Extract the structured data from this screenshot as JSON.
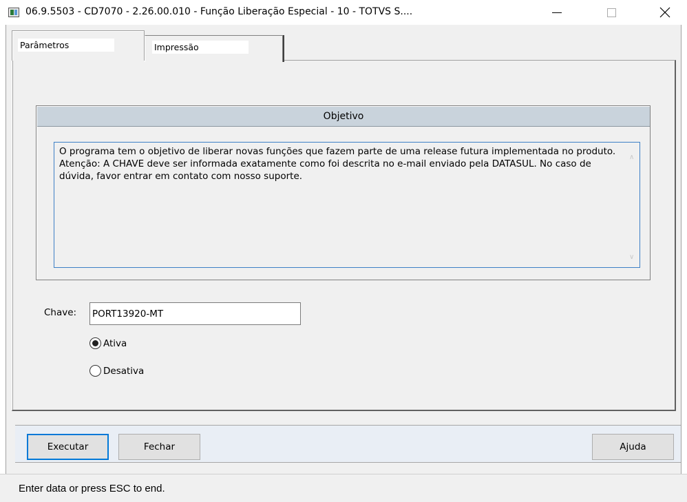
{
  "window": {
    "title": "06.9.5503 - CD7070 - 2.26.00.010 - Função Liberação Especial - 10 - TOTVS S...."
  },
  "tabs": [
    {
      "label": "Parâmetros",
      "active": true
    },
    {
      "label": "Impressão",
      "active": false
    }
  ],
  "objetivo": {
    "header": "Objetivo",
    "text": "O programa tem o objetivo de liberar novas funções que fazem parte de uma release futura implementada no produto. Atenção: A CHAVE deve ser informada exatamente como foi descrita no e-mail enviado pela DATASUL. No caso de dúvida, favor entrar em contato com nosso suporte."
  },
  "chave": {
    "label": "Chave:",
    "value": "PORT13920-MT"
  },
  "radios": [
    {
      "label": "Ativa",
      "checked": true
    },
    {
      "label": "Desativa",
      "checked": false
    }
  ],
  "buttons": {
    "executar": "Executar",
    "fechar": "Fechar",
    "ajuda": "Ajuda"
  },
  "status": {
    "text": "Enter data or press ESC to end."
  }
}
